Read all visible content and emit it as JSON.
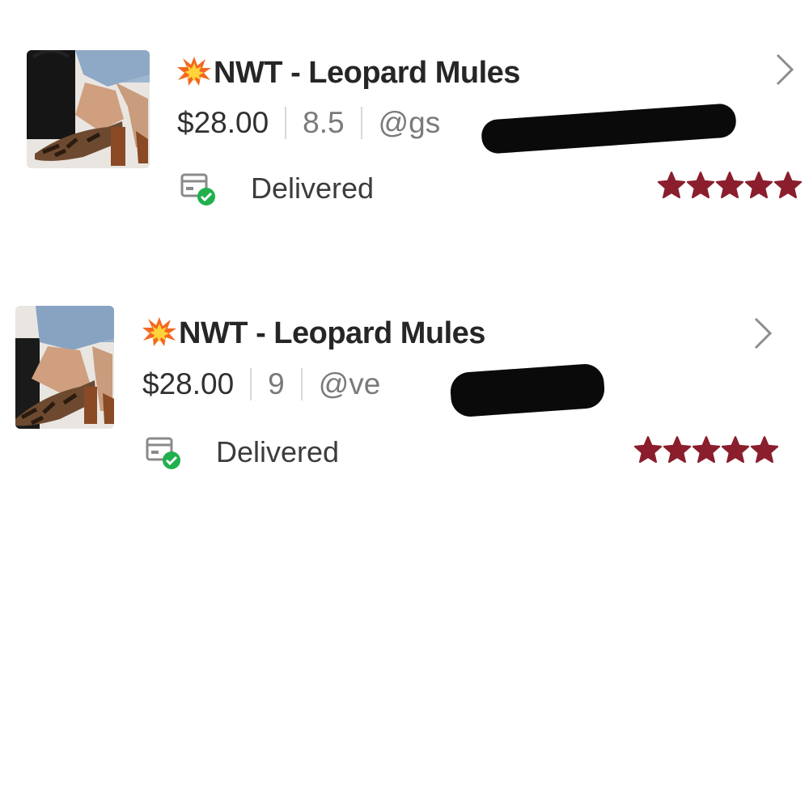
{
  "orders": [
    {
      "title": "NWT - Leopard Mules",
      "price": "$28.00",
      "size": "8.5",
      "user": "@gs",
      "status": "Delivered",
      "rating": 5
    },
    {
      "title": "NWT - Leopard Mules",
      "price": "$28.00",
      "size": "9",
      "user": "@ve",
      "status": "Delivered",
      "rating": 5
    }
  ],
  "icons": {
    "title_prefix": "collision-emoji-icon",
    "status": "package-delivered-icon",
    "open": "chevron-right-icon",
    "rating": "star-icon"
  },
  "colors": {
    "star": "#8b1e2d",
    "delivered_check": "#21b04b",
    "redaction": "#0a0a0a"
  }
}
